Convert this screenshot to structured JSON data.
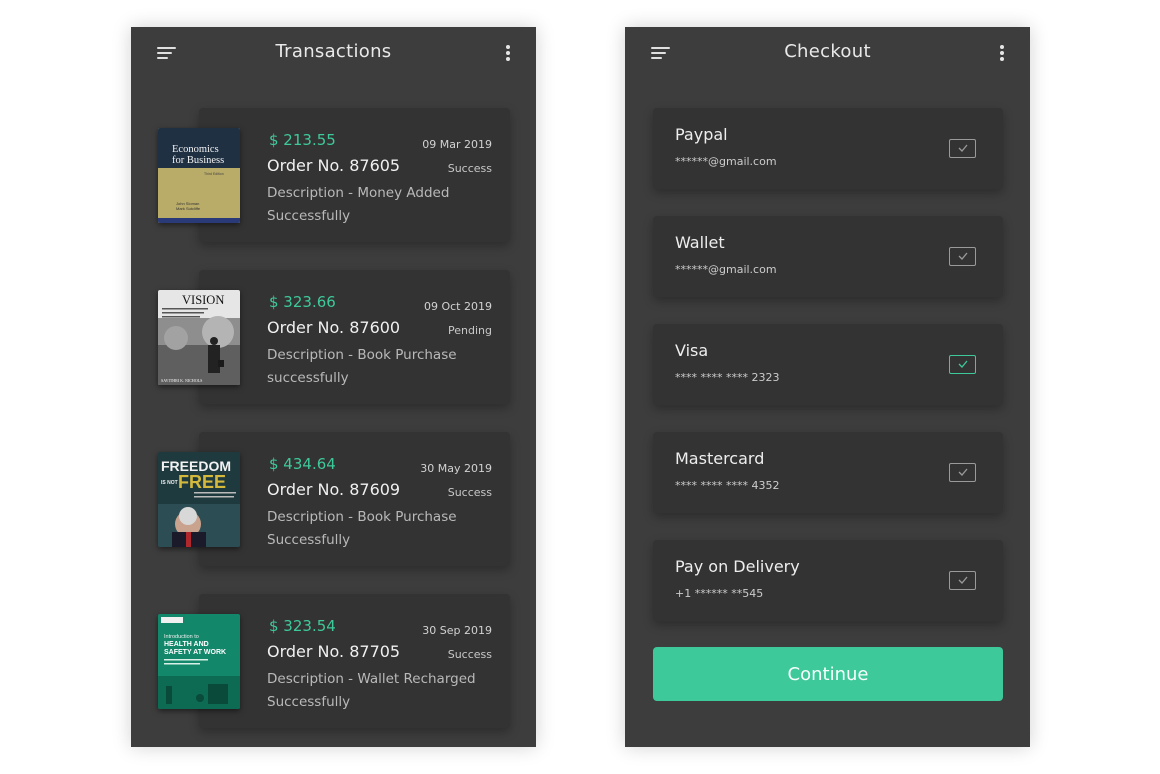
{
  "colors": {
    "accent": "#3ec99b",
    "screen_bg": "#3d3d3d",
    "card_bg": "#333333",
    "text_primary": "#f0f0f0",
    "text_secondary": "#b9b9b9"
  },
  "transactions": {
    "title": "Transactions",
    "icons": {
      "menu": "menu-icon",
      "more": "more-vertical-icon"
    },
    "items": [
      {
        "amount": "$ 213.55",
        "date": "09 Mar 2019",
        "order": "Order No. 87605",
        "status": "Success",
        "desc_line1": "Description - Money Added",
        "desc_line2": "Successfully",
        "cover": {
          "title_line1": "Economics",
          "title_line2": "for Business",
          "edition": "Third Edition",
          "authors_line1": "John Sloman",
          "authors_line2": "Mark Sutcliffe"
        }
      },
      {
        "amount": "$ 323.66",
        "date": "09 Oct 2019",
        "order": "Order No. 87600",
        "status": "Pending",
        "desc_line1": "Description - Book Purchase",
        "desc_line2": "successfully",
        "cover": {
          "title": "VISION",
          "author": "SAVITHRI K. NICHOLS"
        }
      },
      {
        "amount": "$ 434.64",
        "date": "30 May 2019",
        "order": "Order No. 87609",
        "status": "Success",
        "desc_line1": "Description - Book Purchase",
        "desc_line2": "Successfully",
        "cover": {
          "title_line1": "FREEDOM",
          "title_small": "IS NOT",
          "title_line2": "FREE"
        }
      },
      {
        "amount": "$ 323.54",
        "date": "30 Sep 2019",
        "order": "Order No. 87705",
        "status": "Success",
        "desc_line1": "Description - Wallet Recharged",
        "desc_line2": "Successfully",
        "cover": {
          "title_line1": "Introduction to",
          "title_line2": "HEALTH AND",
          "title_line3": "SAFETY AT WORK"
        }
      }
    ]
  },
  "checkout": {
    "title": "Checkout",
    "icons": {
      "menu": "menu-icon",
      "more": "more-vertical-icon"
    },
    "methods": [
      {
        "name": "Paypal",
        "detail": "******@gmail.com",
        "checked": false
      },
      {
        "name": "Wallet",
        "detail": "******@gmail.com",
        "checked": false
      },
      {
        "name": "Visa",
        "detail": "**** **** **** 2323",
        "checked": true
      },
      {
        "name": "Mastercard",
        "detail": "**** **** **** 4352",
        "checked": false
      },
      {
        "name": "Pay on Delivery",
        "detail": "+1 ****** **545",
        "checked": false
      }
    ],
    "continue_label": "Continue"
  }
}
